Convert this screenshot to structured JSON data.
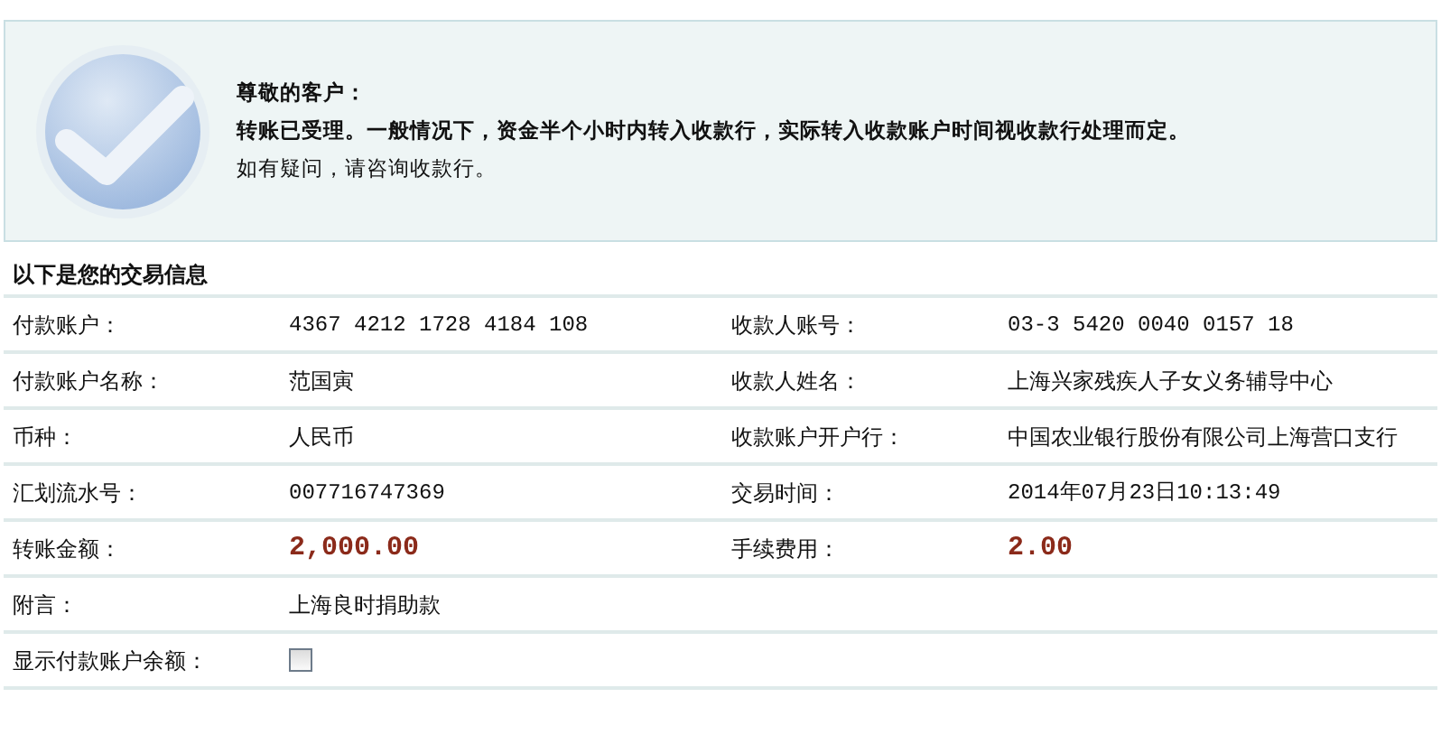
{
  "notice": {
    "greeting": "尊敬的客户：",
    "message": "转账已受理。一般情况下，资金半个小时内转入收款行，实际转入收款账户时间视收款行处理而定。",
    "hint": "如有疑问，请咨询收款行。"
  },
  "details": {
    "title": "以下是您的交易信息",
    "rows": [
      {
        "fields": [
          {
            "label": "付款账户：",
            "kind": "mono",
            "value": "4367 4212 1728 4184 108"
          },
          {
            "label": "收款人账号：",
            "kind": "mono",
            "value": "03-3 5420 0040 0157 18"
          }
        ]
      },
      {
        "fields": [
          {
            "label": "付款账户名称：",
            "kind": "text",
            "value": "范国寅"
          },
          {
            "label": "收款人姓名：",
            "kind": "text",
            "value": "上海兴家残疾人子女义务辅导中心"
          }
        ]
      },
      {
        "fields": [
          {
            "label": "币种：",
            "kind": "text",
            "value": "人民币"
          },
          {
            "label": "收款账户开户行：",
            "kind": "text",
            "value": "中国农业银行股份有限公司上海营口支行"
          }
        ]
      },
      {
        "fields": [
          {
            "label": "汇划流水号：",
            "kind": "mono",
            "value": "007716747369"
          },
          {
            "label": "交易时间：",
            "kind": "mono",
            "value": "2014年07月23日10:13:49"
          }
        ]
      },
      {
        "fields": [
          {
            "label": "转账金额：",
            "kind": "amount",
            "value": "2,000.00"
          },
          {
            "label": "手续费用：",
            "kind": "amount",
            "value": "2.00"
          }
        ]
      },
      {
        "fields": [
          {
            "label": "附言：",
            "kind": "text",
            "value": "上海良时捐助款"
          }
        ]
      },
      {
        "fields": [
          {
            "label": "显示付款账户余额：",
            "kind": "checkbox",
            "checked": false
          }
        ]
      }
    ]
  }
}
